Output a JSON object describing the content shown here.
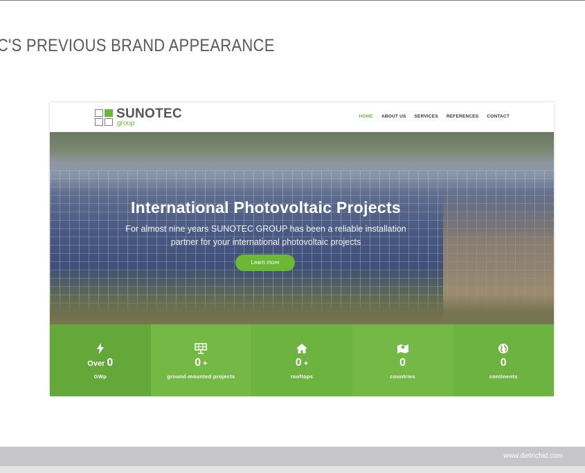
{
  "slide": {
    "title": "C'S PREVIOUS BRAND APPEARANCE",
    "footer_url": "www.dietrichid.com"
  },
  "site": {
    "logo": {
      "name": "SUNOTEC",
      "sub": "group"
    },
    "nav": [
      {
        "label": "HOME",
        "active": true
      },
      {
        "label": "ABOUT US",
        "active": false
      },
      {
        "label": "SERVICES",
        "active": false
      },
      {
        "label": "REFERENCES",
        "active": false
      },
      {
        "label": "CONTACT",
        "active": false
      }
    ],
    "hero": {
      "title": "International Photovoltaic Projects",
      "subtitle_line1": "For almost nine years SUNOTEC GROUP has been a reliable installation",
      "subtitle_line2": "partner for your international photovoltaic projects",
      "button": "Learn more"
    },
    "stats": [
      {
        "icon": "lightning-icon",
        "prefix": "Over ",
        "value": "0",
        "suffix": "",
        "label": "GWp"
      },
      {
        "icon": "solar-panel-icon",
        "prefix": "",
        "value": "0",
        "suffix": " +",
        "label": "ground-mounted projects"
      },
      {
        "icon": "house-icon",
        "prefix": "",
        "value": "0",
        "suffix": " +",
        "label": "rooftops"
      },
      {
        "icon": "map-icon",
        "prefix": "",
        "value": "0",
        "suffix": "",
        "label": "countries"
      },
      {
        "icon": "globe-icon",
        "prefix": "",
        "value": "0",
        "suffix": "",
        "label": "continents"
      }
    ]
  },
  "colors": {
    "brand_green": "#6bb736",
    "slide_text": "#5a5a5a",
    "footer_bar": "#c6c6c8"
  }
}
